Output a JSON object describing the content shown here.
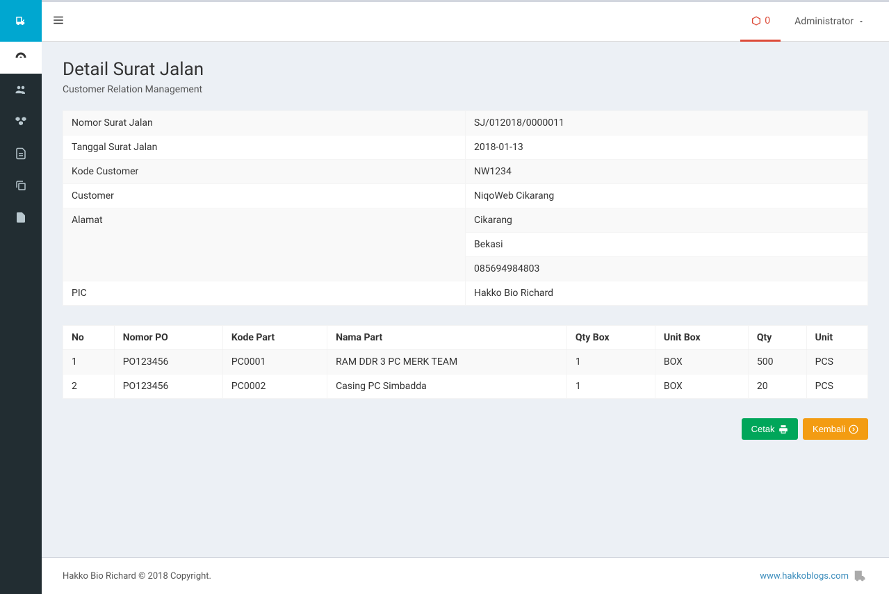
{
  "navbar": {
    "notif_count": "0",
    "user_label": "Administrator"
  },
  "page": {
    "title": "Detail Surat Jalan",
    "subtitle": "Customer Relation Management"
  },
  "detail": {
    "labels": {
      "nomor_sj": "Nomor Surat Jalan",
      "tanggal_sj": "Tanggal Surat Jalan",
      "kode_customer": "Kode Customer",
      "customer": "Customer",
      "alamat": "Alamat",
      "pic": "PIC"
    },
    "values": {
      "nomor_sj": "SJ/012018/0000011",
      "tanggal_sj": "2018-01-13",
      "kode_customer": "NW1234",
      "customer": "NiqoWeb Cikarang",
      "alamat_1": "Cikarang",
      "alamat_2": "Bekasi",
      "alamat_3": "085694984803",
      "pic": "Hakko Bio Richard"
    }
  },
  "items": {
    "headers": {
      "no": "No",
      "nomor_po": "Nomor PO",
      "kode_part": "Kode Part",
      "nama_part": "Nama Part",
      "qty_box": "Qty Box",
      "unit_box": "Unit Box",
      "qty": "Qty",
      "unit": "Unit"
    },
    "rows": [
      {
        "no": "1",
        "nomor_po": "PO123456",
        "kode_part": "PC0001",
        "nama_part": "RAM DDR 3 PC MERK TEAM",
        "qty_box": "1",
        "unit_box": "BOX",
        "qty": "500",
        "unit": "PCS"
      },
      {
        "no": "2",
        "nomor_po": "PO123456",
        "kode_part": "PC0002",
        "nama_part": "Casing PC Simbadda",
        "qty_box": "1",
        "unit_box": "BOX",
        "qty": "20",
        "unit": "PCS"
      }
    ]
  },
  "buttons": {
    "cetak": "Cetak",
    "kembali": "Kembali"
  },
  "footer": {
    "left": "Hakko Bio Richard © 2018 Copyright.",
    "right": "www.hakkoblogs.com"
  }
}
